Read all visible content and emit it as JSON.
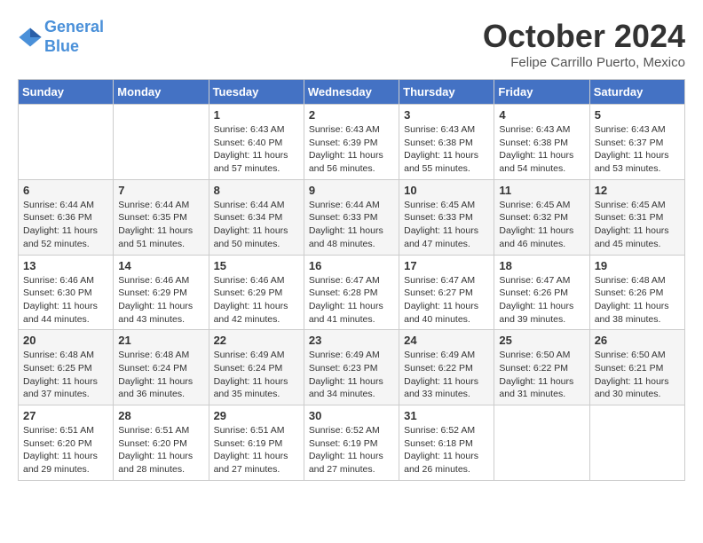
{
  "header": {
    "logo_line1": "General",
    "logo_line2": "Blue",
    "month": "October 2024",
    "location": "Felipe Carrillo Puerto, Mexico"
  },
  "days_of_week": [
    "Sunday",
    "Monday",
    "Tuesday",
    "Wednesday",
    "Thursday",
    "Friday",
    "Saturday"
  ],
  "weeks": [
    [
      {
        "day": "",
        "sunrise": "",
        "sunset": "",
        "daylight": ""
      },
      {
        "day": "",
        "sunrise": "",
        "sunset": "",
        "daylight": ""
      },
      {
        "day": "1",
        "sunrise": "Sunrise: 6:43 AM",
        "sunset": "Sunset: 6:40 PM",
        "daylight": "Daylight: 11 hours and 57 minutes."
      },
      {
        "day": "2",
        "sunrise": "Sunrise: 6:43 AM",
        "sunset": "Sunset: 6:39 PM",
        "daylight": "Daylight: 11 hours and 56 minutes."
      },
      {
        "day": "3",
        "sunrise": "Sunrise: 6:43 AM",
        "sunset": "Sunset: 6:38 PM",
        "daylight": "Daylight: 11 hours and 55 minutes."
      },
      {
        "day": "4",
        "sunrise": "Sunrise: 6:43 AM",
        "sunset": "Sunset: 6:38 PM",
        "daylight": "Daylight: 11 hours and 54 minutes."
      },
      {
        "day": "5",
        "sunrise": "Sunrise: 6:43 AM",
        "sunset": "Sunset: 6:37 PM",
        "daylight": "Daylight: 11 hours and 53 minutes."
      }
    ],
    [
      {
        "day": "6",
        "sunrise": "Sunrise: 6:44 AM",
        "sunset": "Sunset: 6:36 PM",
        "daylight": "Daylight: 11 hours and 52 minutes."
      },
      {
        "day": "7",
        "sunrise": "Sunrise: 6:44 AM",
        "sunset": "Sunset: 6:35 PM",
        "daylight": "Daylight: 11 hours and 51 minutes."
      },
      {
        "day": "8",
        "sunrise": "Sunrise: 6:44 AM",
        "sunset": "Sunset: 6:34 PM",
        "daylight": "Daylight: 11 hours and 50 minutes."
      },
      {
        "day": "9",
        "sunrise": "Sunrise: 6:44 AM",
        "sunset": "Sunset: 6:33 PM",
        "daylight": "Daylight: 11 hours and 48 minutes."
      },
      {
        "day": "10",
        "sunrise": "Sunrise: 6:45 AM",
        "sunset": "Sunset: 6:33 PM",
        "daylight": "Daylight: 11 hours and 47 minutes."
      },
      {
        "day": "11",
        "sunrise": "Sunrise: 6:45 AM",
        "sunset": "Sunset: 6:32 PM",
        "daylight": "Daylight: 11 hours and 46 minutes."
      },
      {
        "day": "12",
        "sunrise": "Sunrise: 6:45 AM",
        "sunset": "Sunset: 6:31 PM",
        "daylight": "Daylight: 11 hours and 45 minutes."
      }
    ],
    [
      {
        "day": "13",
        "sunrise": "Sunrise: 6:46 AM",
        "sunset": "Sunset: 6:30 PM",
        "daylight": "Daylight: 11 hours and 44 minutes."
      },
      {
        "day": "14",
        "sunrise": "Sunrise: 6:46 AM",
        "sunset": "Sunset: 6:29 PM",
        "daylight": "Daylight: 11 hours and 43 minutes."
      },
      {
        "day": "15",
        "sunrise": "Sunrise: 6:46 AM",
        "sunset": "Sunset: 6:29 PM",
        "daylight": "Daylight: 11 hours and 42 minutes."
      },
      {
        "day": "16",
        "sunrise": "Sunrise: 6:47 AM",
        "sunset": "Sunset: 6:28 PM",
        "daylight": "Daylight: 11 hours and 41 minutes."
      },
      {
        "day": "17",
        "sunrise": "Sunrise: 6:47 AM",
        "sunset": "Sunset: 6:27 PM",
        "daylight": "Daylight: 11 hours and 40 minutes."
      },
      {
        "day": "18",
        "sunrise": "Sunrise: 6:47 AM",
        "sunset": "Sunset: 6:26 PM",
        "daylight": "Daylight: 11 hours and 39 minutes."
      },
      {
        "day": "19",
        "sunrise": "Sunrise: 6:48 AM",
        "sunset": "Sunset: 6:26 PM",
        "daylight": "Daylight: 11 hours and 38 minutes."
      }
    ],
    [
      {
        "day": "20",
        "sunrise": "Sunrise: 6:48 AM",
        "sunset": "Sunset: 6:25 PM",
        "daylight": "Daylight: 11 hours and 37 minutes."
      },
      {
        "day": "21",
        "sunrise": "Sunrise: 6:48 AM",
        "sunset": "Sunset: 6:24 PM",
        "daylight": "Daylight: 11 hours and 36 minutes."
      },
      {
        "day": "22",
        "sunrise": "Sunrise: 6:49 AM",
        "sunset": "Sunset: 6:24 PM",
        "daylight": "Daylight: 11 hours and 35 minutes."
      },
      {
        "day": "23",
        "sunrise": "Sunrise: 6:49 AM",
        "sunset": "Sunset: 6:23 PM",
        "daylight": "Daylight: 11 hours and 34 minutes."
      },
      {
        "day": "24",
        "sunrise": "Sunrise: 6:49 AM",
        "sunset": "Sunset: 6:22 PM",
        "daylight": "Daylight: 11 hours and 33 minutes."
      },
      {
        "day": "25",
        "sunrise": "Sunrise: 6:50 AM",
        "sunset": "Sunset: 6:22 PM",
        "daylight": "Daylight: 11 hours and 31 minutes."
      },
      {
        "day": "26",
        "sunrise": "Sunrise: 6:50 AM",
        "sunset": "Sunset: 6:21 PM",
        "daylight": "Daylight: 11 hours and 30 minutes."
      }
    ],
    [
      {
        "day": "27",
        "sunrise": "Sunrise: 6:51 AM",
        "sunset": "Sunset: 6:20 PM",
        "daylight": "Daylight: 11 hours and 29 minutes."
      },
      {
        "day": "28",
        "sunrise": "Sunrise: 6:51 AM",
        "sunset": "Sunset: 6:20 PM",
        "daylight": "Daylight: 11 hours and 28 minutes."
      },
      {
        "day": "29",
        "sunrise": "Sunrise: 6:51 AM",
        "sunset": "Sunset: 6:19 PM",
        "daylight": "Daylight: 11 hours and 27 minutes."
      },
      {
        "day": "30",
        "sunrise": "Sunrise: 6:52 AM",
        "sunset": "Sunset: 6:19 PM",
        "daylight": "Daylight: 11 hours and 27 minutes."
      },
      {
        "day": "31",
        "sunrise": "Sunrise: 6:52 AM",
        "sunset": "Sunset: 6:18 PM",
        "daylight": "Daylight: 11 hours and 26 minutes."
      },
      {
        "day": "",
        "sunrise": "",
        "sunset": "",
        "daylight": ""
      },
      {
        "day": "",
        "sunrise": "",
        "sunset": "",
        "daylight": ""
      }
    ]
  ]
}
